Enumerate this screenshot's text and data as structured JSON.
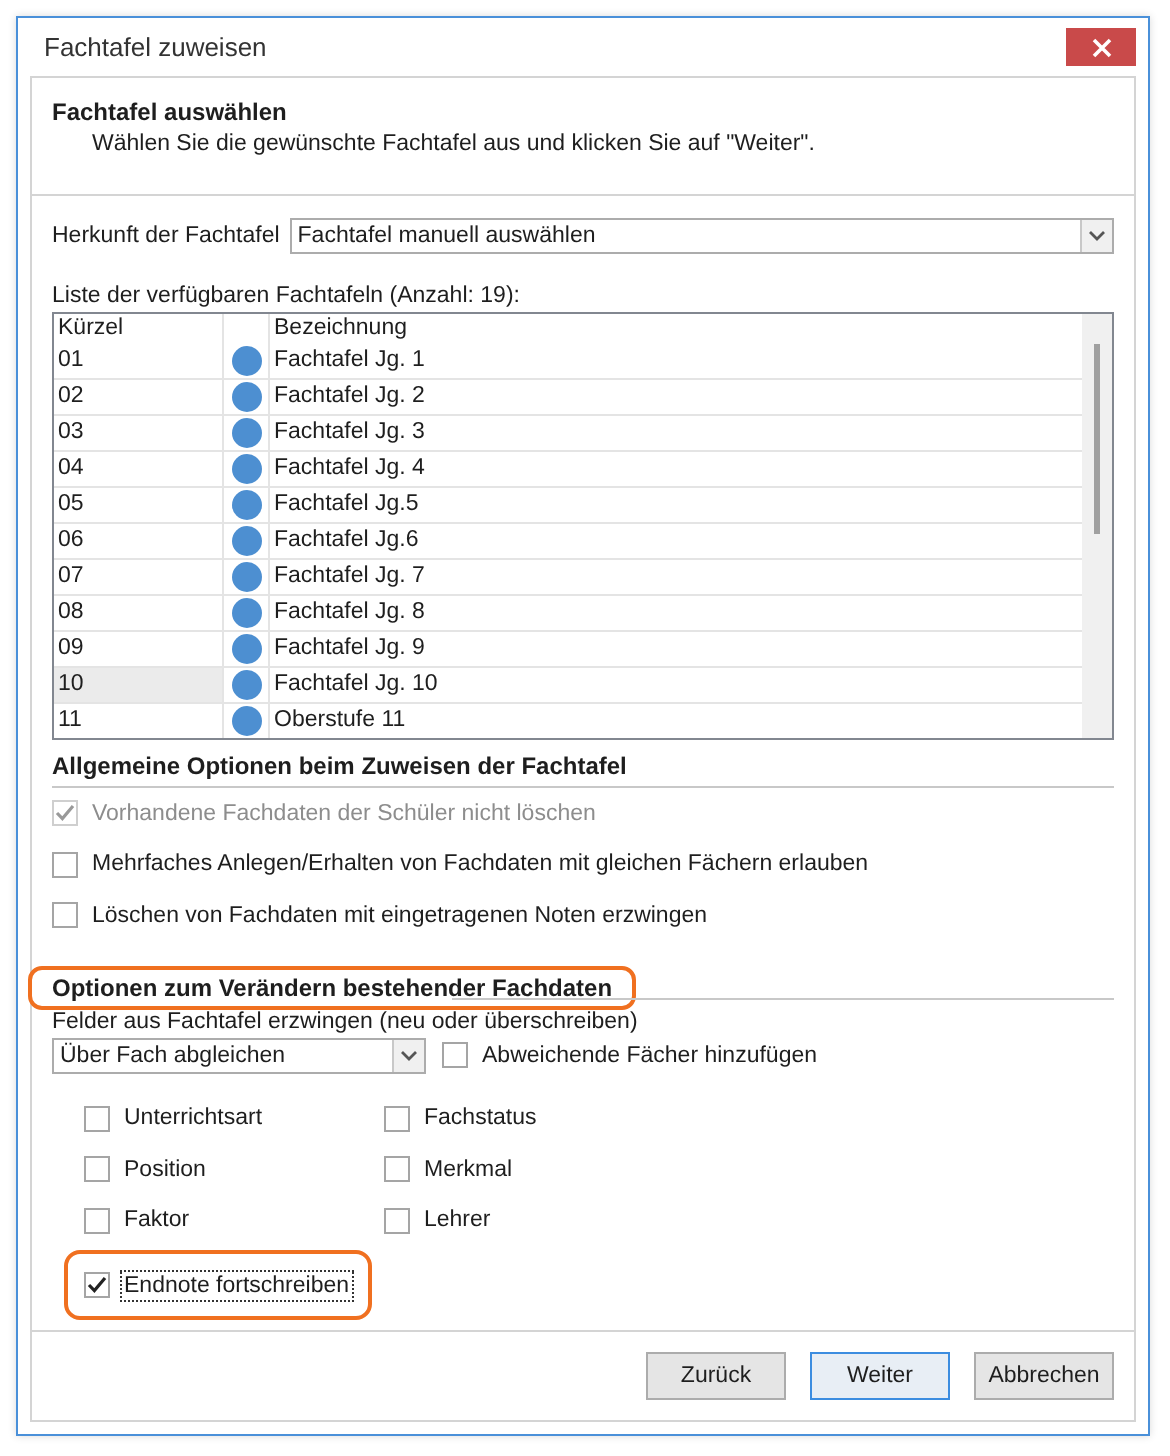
{
  "window": {
    "title": "Fachtafel zuweisen"
  },
  "header": {
    "title": "Fachtafel auswählen",
    "subtitle": "Wählen Sie die gewünschte Fachtafel aus und klicken Sie auf \"Weiter\"."
  },
  "source": {
    "label": "Herkunft der Fachtafel",
    "value": "Fachtafel manuell auswählen"
  },
  "list": {
    "label": "Liste der verfügbaren Fachtafeln (Anzahl: 19):",
    "columns": [
      "Kürzel",
      "Bezeichnung"
    ],
    "rows": [
      {
        "code": "01",
        "name": "Fachtafel Jg. 1",
        "selected": false
      },
      {
        "code": "02",
        "name": "Fachtafel Jg. 2",
        "selected": false
      },
      {
        "code": "03",
        "name": "Fachtafel Jg. 3",
        "selected": false
      },
      {
        "code": "04",
        "name": "Fachtafel Jg. 4",
        "selected": false
      },
      {
        "code": "05",
        "name": "Fachtafel Jg.5",
        "selected": false
      },
      {
        "code": "06",
        "name": "Fachtafel Jg.6",
        "selected": false
      },
      {
        "code": "07",
        "name": "Fachtafel Jg. 7",
        "selected": false
      },
      {
        "code": "08",
        "name": "Fachtafel Jg. 8",
        "selected": false
      },
      {
        "code": "09",
        "name": "Fachtafel Jg. 9",
        "selected": false
      },
      {
        "code": "10",
        "name": "Fachtafel Jg. 10",
        "selected": true
      },
      {
        "code": "11",
        "name": "Oberstufe 11",
        "selected": false
      }
    ]
  },
  "general_options": {
    "heading": "Allgemeine Optionen beim Zuweisen der Fachtafel",
    "options": [
      {
        "label": "Vorhandene Fachdaten der Schüler nicht löschen",
        "checked": true,
        "disabled": true
      },
      {
        "label": "Mehrfaches Anlegen/Erhalten von Fachdaten mit gleichen Fächern erlauben",
        "checked": false,
        "disabled": false
      },
      {
        "label": "Löschen von Fachdaten mit eingetragenen Noten erzwingen",
        "checked": false,
        "disabled": false
      }
    ]
  },
  "change_options": {
    "heading": "Optionen zum Verändern bestehender Fachdaten",
    "highlighted": true,
    "fields_label": "Felder aus Fachtafel erzwingen (neu oder überschreiben)",
    "mode": "Über Fach abgleichen",
    "add_different": {
      "label": "Abweichende Fächer hinzufügen",
      "checked": false
    },
    "fields": [
      {
        "label": "Unterrichtsart",
        "checked": false,
        "highlighted": false,
        "focused": false
      },
      {
        "label": "Position",
        "checked": false,
        "highlighted": false,
        "focused": false
      },
      {
        "label": "Faktor",
        "checked": false,
        "highlighted": false,
        "focused": false
      },
      {
        "label": "Endnote fortschreiben",
        "checked": true,
        "highlighted": true,
        "focused": true
      },
      {
        "label": "Fachstatus",
        "checked": false,
        "highlighted": false,
        "focused": false
      },
      {
        "label": "Merkmal",
        "checked": false,
        "highlighted": false,
        "focused": false
      },
      {
        "label": "Lehrer",
        "checked": false,
        "highlighted": false,
        "focused": false
      }
    ]
  },
  "buttons": [
    {
      "label": "Zurück",
      "default": false
    },
    {
      "label": "Weiter",
      "default": true
    },
    {
      "label": "Abbrechen",
      "default": false
    }
  ]
}
